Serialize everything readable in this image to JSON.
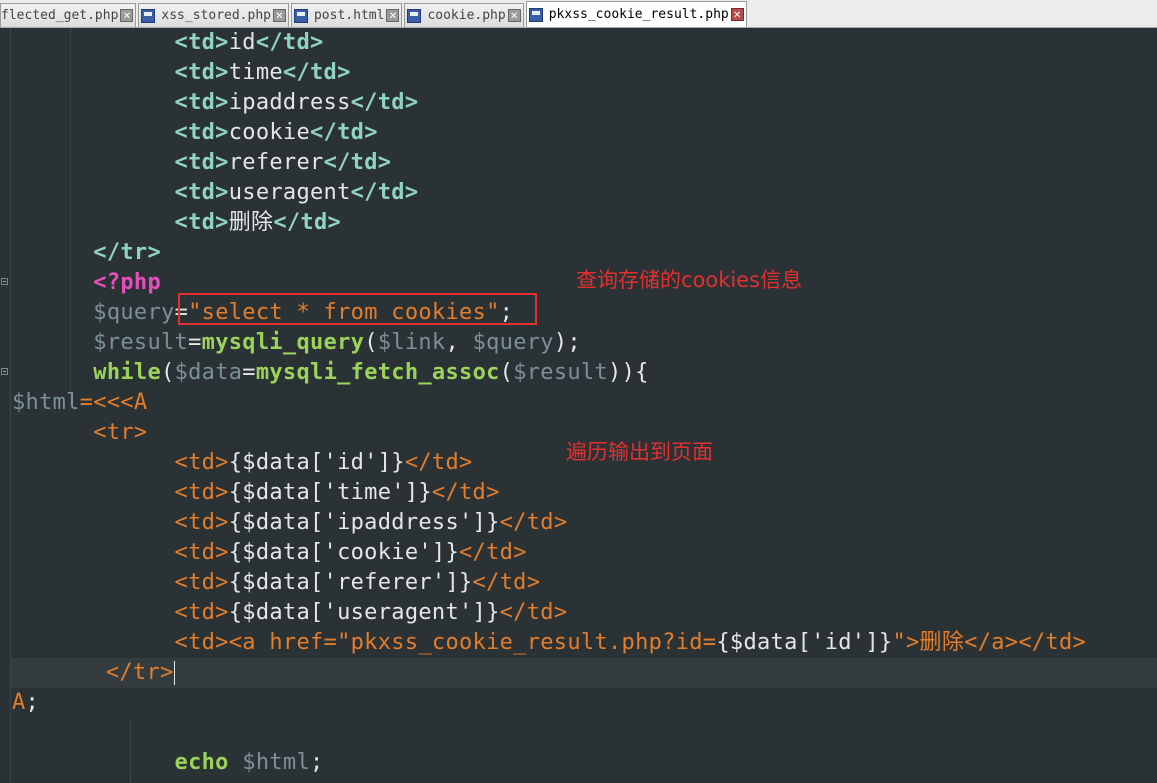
{
  "tabs": [
    {
      "label": "flected_get.php",
      "active": false
    },
    {
      "label": "xss_stored.php",
      "active": false
    },
    {
      "label": "post.html",
      "active": false
    },
    {
      "label": "cookie.php",
      "active": false
    },
    {
      "label": "pkxss_cookie_result.php",
      "active": true
    }
  ],
  "tab_close_glyph": "✕",
  "code": {
    "l1_td": "<td>",
    "l1_text": "id",
    "l1_end": "</td>",
    "l2_td": "<td>",
    "l2_text": "time",
    "l2_end": "</td>",
    "l3_td": "<td>",
    "l3_text": "ipaddress",
    "l3_end": "</td>",
    "l4_td": "<td>",
    "l4_text": "cookie",
    "l4_end": "</td>",
    "l5_td": "<td>",
    "l5_text": "referer",
    "l5_end": "</td>",
    "l6_td": "<td>",
    "l6_text": "useragent",
    "l6_end": "</td>",
    "l7_td": "<td>",
    "l7_text": "删除",
    "l7_end": "</td>",
    "l8_tr": "</tr>",
    "l9_php": "<?php",
    "l10_var": "$query",
    "l10_eq": "=",
    "l10_str": "\"select * from cookies\"",
    "l10_semi": ";",
    "l11_var": "$result",
    "l11_eq": "=",
    "l11_fn": "mysqli_query",
    "l11_open": "(",
    "l11_arg1": "$link",
    "l11_comma": ", ",
    "l11_arg2": "$query",
    "l11_close": ");",
    "l12_kw": "while",
    "l12_open": "(",
    "l12_var": "$data",
    "l12_eq": "=",
    "l12_fn": "mysqli_fetch_assoc",
    "l12_open2": "(",
    "l12_arg": "$result",
    "l12_close": ")){",
    "l13_var": "$html",
    "l13_heredoc": "=<<<A",
    "l14": "<tr>",
    "l15_open": "<td>",
    "l15_val": "{$data['id']}",
    "l15_close": "</td>",
    "l16_open": "<td>",
    "l16_val": "{$data['time']}",
    "l16_close": "</td>",
    "l17_open": "<td>",
    "l17_val": "{$data['ipaddress']}",
    "l17_close": "</td>",
    "l18_open": "<td>",
    "l18_val": "{$data['cookie']}",
    "l18_close": "</td>",
    "l19_open": "<td>",
    "l19_val": "{$data['referer']}",
    "l19_close": "</td>",
    "l20_open": "<td>",
    "l20_val": "{$data['useragent']}",
    "l20_close": "</td>",
    "l21_open": "<td><a href=\"pkxss_cookie_result.php?id=",
    "l21_val": "{$data['id']}",
    "l21_mid": "\">",
    "l21_text": "删除",
    "l21_close": "</a></td>",
    "l22": "</tr>",
    "l23_end": "A",
    "l23_semi": ";",
    "l25_kw": "echo",
    "l25_var": "$html",
    "l25_semi": ";"
  },
  "annotations": {
    "query_note": "查询存储的cookies信息",
    "loop_note": "遍历输出到页面"
  }
}
